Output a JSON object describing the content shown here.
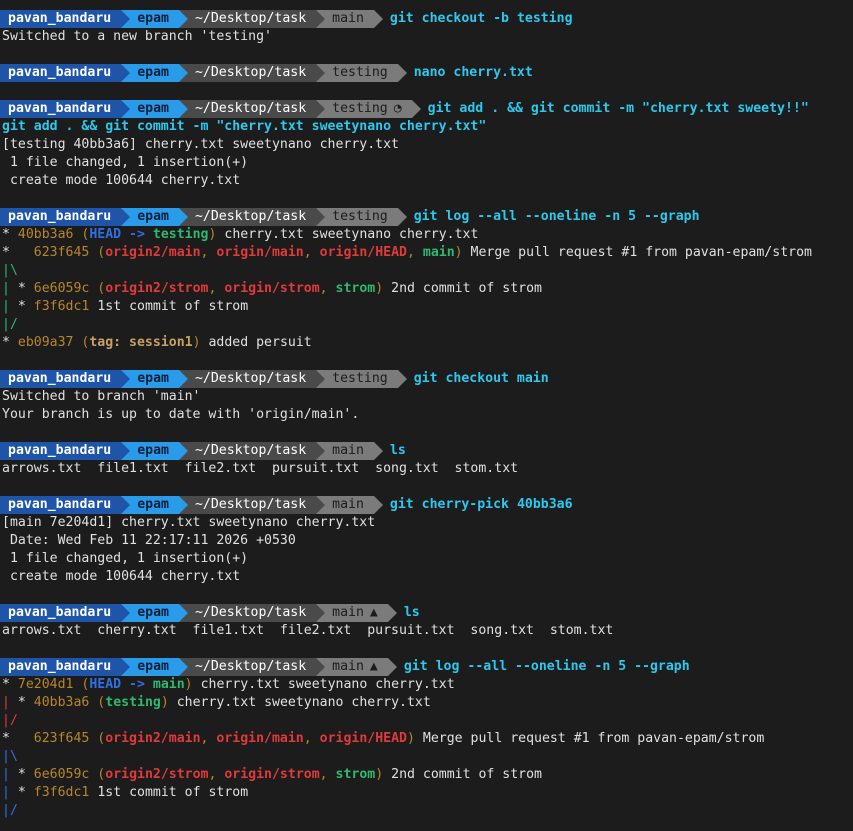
{
  "prompt": {
    "user": "pavan_bandaru",
    "env": "epam",
    "path": "~/Desktop/task"
  },
  "blocks": [
    {
      "branch": "main",
      "branch_status": "",
      "command": "git checkout -b testing",
      "output": [
        "Switched to a new branch 'testing'"
      ]
    },
    {
      "branch": "testing",
      "branch_status": "",
      "command": "nano cherry.txt",
      "output": []
    },
    {
      "branch": "testing",
      "branch_status": "◔",
      "command": "git add . && git commit -m \"cherry.txt sweety!!\"",
      "continuation": "git add . && git commit -m \"cherry.txt sweetynano cherry.txt\"",
      "output": [
        "[testing 40bb3a6] cherry.txt sweetynano cherry.txt",
        " 1 file changed, 1 insertion(+)",
        " create mode 100644 cherry.txt"
      ]
    },
    {
      "branch": "testing",
      "branch_status": "",
      "command": "git log --all --oneline -n 5 --graph",
      "log": "log1"
    },
    {
      "branch": "testing",
      "branch_status": "",
      "command": "git checkout main",
      "output": [
        "Switched to branch 'main'",
        "Your branch is up to date with 'origin/main'."
      ]
    },
    {
      "branch": "main",
      "branch_status": "",
      "command": "ls",
      "output": [
        "arrows.txt  file1.txt  file2.txt  pursuit.txt  song.txt  stom.txt"
      ]
    },
    {
      "branch": "main",
      "branch_status": "",
      "command": "git cherry-pick 40bb3a6",
      "output": [
        "[main 7e204d1] cherry.txt sweetynano cherry.txt",
        " Date: Wed Feb 11 22:17:11 2026 +0530",
        " 1 file changed, 1 insertion(+)",
        " create mode 100644 cherry.txt"
      ]
    },
    {
      "branch": "main",
      "branch_status": "▲",
      "command": "ls",
      "output": [
        "arrows.txt  cherry.txt  file1.txt  file2.txt  pursuit.txt  song.txt  stom.txt"
      ]
    },
    {
      "branch": "main",
      "branch_status": "▲",
      "command": "git log --all --oneline -n 5 --graph",
      "log": "log2"
    }
  ],
  "log1": [
    {
      "graph": "* ",
      "hash": "40bb3a6",
      "refs": [
        {
          "t": "head",
          "v": "HEAD -> "
        },
        {
          "t": "local",
          "v": "testing"
        }
      ],
      "msg": "cherry.txt sweetynano cherry.txt"
    },
    {
      "graph": "*   ",
      "hash": "623f645",
      "refs": [
        {
          "t": "remote",
          "v": "origin2/main"
        },
        {
          "t": "sep",
          "v": ", "
        },
        {
          "t": "remote",
          "v": "origin/main"
        },
        {
          "t": "sep",
          "v": ", "
        },
        {
          "t": "remote",
          "v": "origin/HEAD"
        },
        {
          "t": "sep",
          "v": ", "
        },
        {
          "t": "local",
          "v": "main"
        }
      ],
      "msg": "Merge pull request #1 from pavan-epam/strom"
    },
    {
      "graph": "|\\",
      "graphColor": "green"
    },
    {
      "graph": "| * ",
      "graphColor": "green",
      "hash": "6e6059c",
      "refs": [
        {
          "t": "remote",
          "v": "origin2/strom"
        },
        {
          "t": "sep",
          "v": ", "
        },
        {
          "t": "remote",
          "v": "origin/strom"
        },
        {
          "t": "sep",
          "v": ", "
        },
        {
          "t": "local",
          "v": "strom"
        }
      ],
      "msg": "2nd commit of strom"
    },
    {
      "graph": "| * ",
      "graphColor": "green",
      "hash": "f3f6dc1",
      "refs": [],
      "msg": "1st commit of strom"
    },
    {
      "graph": "|/",
      "graphColor": "green"
    },
    {
      "graph": "* ",
      "hash": "eb09a37",
      "refs": [
        {
          "t": "tag",
          "v": "tag: session1"
        }
      ],
      "msg": "added persuit"
    }
  ],
  "log2": [
    {
      "graph": "* ",
      "hash": "7e204d1",
      "refs": [
        {
          "t": "head",
          "v": "HEAD -> "
        },
        {
          "t": "local",
          "v": "main"
        }
      ],
      "msg": "cherry.txt sweetynano cherry.txt"
    },
    {
      "graph": "| * ",
      "graphColor": "red",
      "hash": "40bb3a6",
      "refs": [
        {
          "t": "local",
          "v": "testing"
        }
      ],
      "msg": "cherry.txt sweetynano cherry.txt"
    },
    {
      "graph": "|/",
      "graphColor": "red"
    },
    {
      "graph": "*   ",
      "hash": "623f645",
      "refs": [
        {
          "t": "remote",
          "v": "origin2/main"
        },
        {
          "t": "sep",
          "v": ", "
        },
        {
          "t": "remote",
          "v": "origin/main"
        },
        {
          "t": "sep",
          "v": ", "
        },
        {
          "t": "remote",
          "v": "origin/HEAD"
        }
      ],
      "msg": "Merge pull request #1 from pavan-epam/strom"
    },
    {
      "graph": "|\\",
      "graphColor": "blue"
    },
    {
      "graph": "| * ",
      "graphColor": "blue",
      "hash": "6e6059c",
      "refs": [
        {
          "t": "remote",
          "v": "origin2/strom"
        },
        {
          "t": "sep",
          "v": ", "
        },
        {
          "t": "remote",
          "v": "origin/strom"
        },
        {
          "t": "sep",
          "v": ", "
        },
        {
          "t": "local",
          "v": "strom"
        }
      ],
      "msg": "2nd commit of strom"
    },
    {
      "graph": "| * ",
      "graphColor": "blue",
      "hash": "f3f6dc1",
      "refs": [],
      "msg": "1st commit of strom"
    },
    {
      "graph": "|/",
      "graphColor": "blue"
    }
  ],
  "colors": {
    "background": "#1c1c1c",
    "user_segment": "#1f55a8",
    "env_segment": "#2a9be8",
    "path_segment": "#4a4a4a",
    "branch_segment": "#7b7b7b",
    "command": "#2dc8ee",
    "hash": "#b8862b",
    "head": "#2e6fe6",
    "local_branch": "#2fb86f",
    "remote_branch": "#e03a3a"
  }
}
